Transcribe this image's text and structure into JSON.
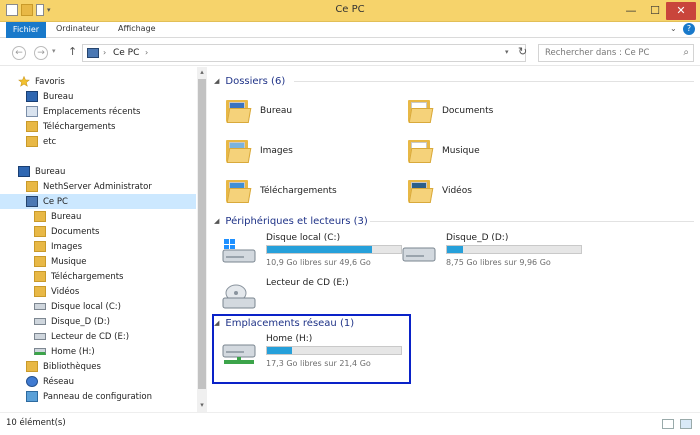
{
  "window": {
    "title": "Ce PC",
    "minimize": "—",
    "maximize": "☐",
    "close": "✕"
  },
  "ribbon": {
    "tabs": [
      "Fichier",
      "Ordinateur",
      "Affichage"
    ],
    "help": "?",
    "expand": "⌄"
  },
  "navbar": {
    "back": "←",
    "forward": "→",
    "up": "↑",
    "refresh": "↻",
    "breadcrumb": "Ce PC",
    "search_placeholder": "Rechercher dans : Ce PC",
    "search_icon": "⌕"
  },
  "sidebar": {
    "favorites_label": "Favoris",
    "favorites": [
      "Bureau",
      "Emplacements récents",
      "Téléchargements",
      "etc"
    ],
    "desktop_label": "Bureau",
    "desktop_items": [
      "NethServer Administrator",
      "Ce PC"
    ],
    "pc_items": [
      "Bureau",
      "Documents",
      "Images",
      "Musique",
      "Téléchargements",
      "Vidéos",
      "Disque local (C:)",
      "Disque_D (D:)",
      "Lecteur de CD (E:)",
      "Home (H:)"
    ],
    "other_items": [
      "Bibliothèques",
      "Réseau",
      "Panneau de configuration"
    ]
  },
  "groups": {
    "folders": {
      "title": "Dossiers (6)",
      "items": [
        "Bureau",
        "Documents",
        "Images",
        "Musique",
        "Téléchargements",
        "Vidéos"
      ]
    },
    "devices": {
      "title": "Périphériques et lecteurs (3)",
      "drives": [
        {
          "name": "Disque local (C:)",
          "free_text": "10,9 Go libres sur 49,6 Go",
          "used_fraction": 0.78
        },
        {
          "name": "Disque_D (D:)",
          "free_text": "8,75 Go libres sur 9,96 Go",
          "used_fraction": 0.12
        },
        {
          "name": "Lecteur de CD (E:)"
        }
      ]
    },
    "network": {
      "title": "Emplacements réseau (1)",
      "drives": [
        {
          "name": "Home (H:)",
          "free_text": "17,3 Go libres sur 21,4 Go",
          "used_fraction": 0.19
        }
      ]
    }
  },
  "status": {
    "count": "10 élément(s)"
  },
  "colors": {
    "titlebar": "#f6d36b",
    "accent": "#1979ca",
    "bar_fill": "#26a0da",
    "highlight_border": "#0a22c8",
    "group_heading": "#1e3287"
  }
}
